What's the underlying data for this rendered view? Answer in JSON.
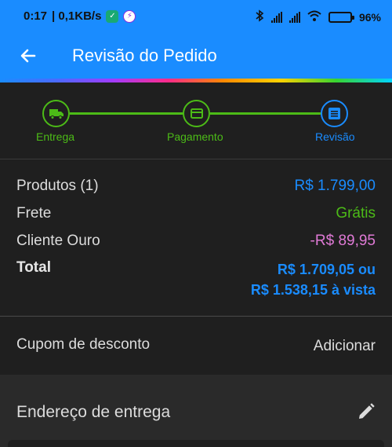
{
  "status_bar": {
    "time": "0:17",
    "speed": "| 0,1KB/s",
    "battery": "96%",
    "battery_level": 0.96,
    "icons": [
      "shield-app-icon",
      "messenger-icon",
      "bluetooth-icon",
      "signal-icon",
      "signal-icon",
      "wifi-icon",
      "battery-icon"
    ]
  },
  "app_bar": {
    "title": "Revisão do Pedido",
    "back_icon": "arrow-left-icon"
  },
  "colors": {
    "primary": "#1a8cff",
    "success": "#4cbb17",
    "discount": "#e07ad6",
    "background": "#1f1f1f"
  },
  "stepper": {
    "steps": [
      {
        "label": "Entrega",
        "icon": "truck-icon",
        "state": "done"
      },
      {
        "label": "Pagamento",
        "icon": "credit-card-icon",
        "state": "done"
      },
      {
        "label": "Revisão",
        "icon": "list-icon",
        "state": "current"
      }
    ]
  },
  "summary": {
    "products_label": "Produtos (1)",
    "products_value": "R$ 1.799,00",
    "shipping_label": "Frete",
    "shipping_value": "Grátis",
    "member_label": "Cliente Ouro",
    "member_value": "-R$ 89,95",
    "total_label": "Total",
    "total_line1": "R$ 1.709,05 ou",
    "total_line2": "R$ 1.538,15 à vista"
  },
  "coupon": {
    "label": "Cupom de desconto",
    "action": "Adicionar"
  },
  "address": {
    "title": "Endereço de entrega",
    "edit_icon": "pencil-icon"
  }
}
